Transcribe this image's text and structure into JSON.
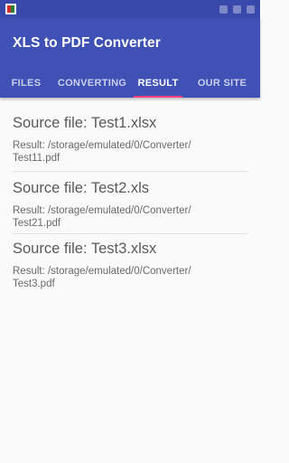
{
  "status_bar": {
    "notification_icon": "app-notification-icon"
  },
  "app": {
    "title": "XLS to PDF Converter",
    "primary_color": "#3f51b5",
    "status_color": "#3949ab",
    "accent_color": "#ff4081"
  },
  "tabs": [
    {
      "label": "FILES",
      "active": false
    },
    {
      "label": "CONVERTING",
      "active": false
    },
    {
      "label": "RESULT",
      "active": true
    },
    {
      "label": "OUR SITE",
      "active": false
    }
  ],
  "results": [
    {
      "source": "Source file: Test1.xlsx",
      "result_line1": "Result: /storage/emulated/0/Converter/",
      "result_line2": "Test11.pdf"
    },
    {
      "source": "Source file: Test2.xls",
      "result_line1": "Result: /storage/emulated/0/Converter/",
      "result_line2": "Test21.pdf"
    },
    {
      "source": "Source file: Test3.xlsx",
      "result_line1": "Result: /storage/emulated/0/Converter/",
      "result_line2": "Test3.pdf"
    }
  ]
}
